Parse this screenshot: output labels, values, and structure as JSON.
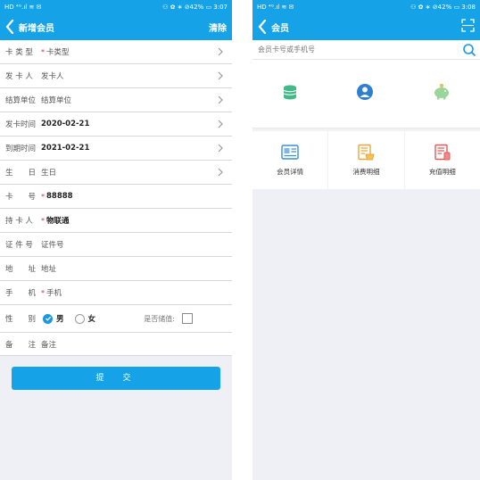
{
  "left": {
    "status": {
      "left": "HD ⁴ᴳ.ıl ≋ ✉",
      "right": "⚇ ✿ ∗ ⊘42% ▭ 3:07"
    },
    "title": "新增会员",
    "clear_label": "清除",
    "rows": {
      "card_type": {
        "label": "卡 类 型",
        "req": "*",
        "value": "卡类型"
      },
      "issuer": {
        "label": "发 卡 人",
        "value": "发卡人"
      },
      "settle_unit": {
        "label": "结算单位",
        "value": "结算单位"
      },
      "issue_time": {
        "label": "发卡时间",
        "value": "2020-02-21"
      },
      "expire_time": {
        "label": "到期时间",
        "value": "2021-02-21"
      },
      "birthday": {
        "label": "生　　日",
        "value": "生日"
      },
      "card_no": {
        "label": "卡　　号",
        "req": "*",
        "value": "88888"
      },
      "holder": {
        "label": "持 卡 人",
        "req": "*",
        "value": "物联通"
      },
      "id_no": {
        "label": "证 件 号",
        "value": "证件号"
      },
      "address": {
        "label": "地　　址",
        "value": "地址"
      },
      "phone": {
        "label": "手　　机",
        "req": "*",
        "value": "手机"
      },
      "gender": {
        "label": "性　　别",
        "male": "男",
        "female": "女",
        "store_label": "是否储值:"
      },
      "remark": {
        "label": "备　　注",
        "value": "备注"
      }
    },
    "submit_label": "提　交"
  },
  "right": {
    "status": {
      "left": "HD ⁴ᴳ.ıl ≋ ✉",
      "right": "⚇ ✿ ∗ ⊘42% ▭ 3:08"
    },
    "title": "会员",
    "search_placeholder": "会员卡号或手机号",
    "tiles": [
      {
        "label": "会员详情"
      },
      {
        "label": "消费明细"
      },
      {
        "label": "充值明细"
      }
    ]
  },
  "colors": {
    "primary": "#16a2e6",
    "required": "#e0302d",
    "bg": "#eef0f5"
  }
}
